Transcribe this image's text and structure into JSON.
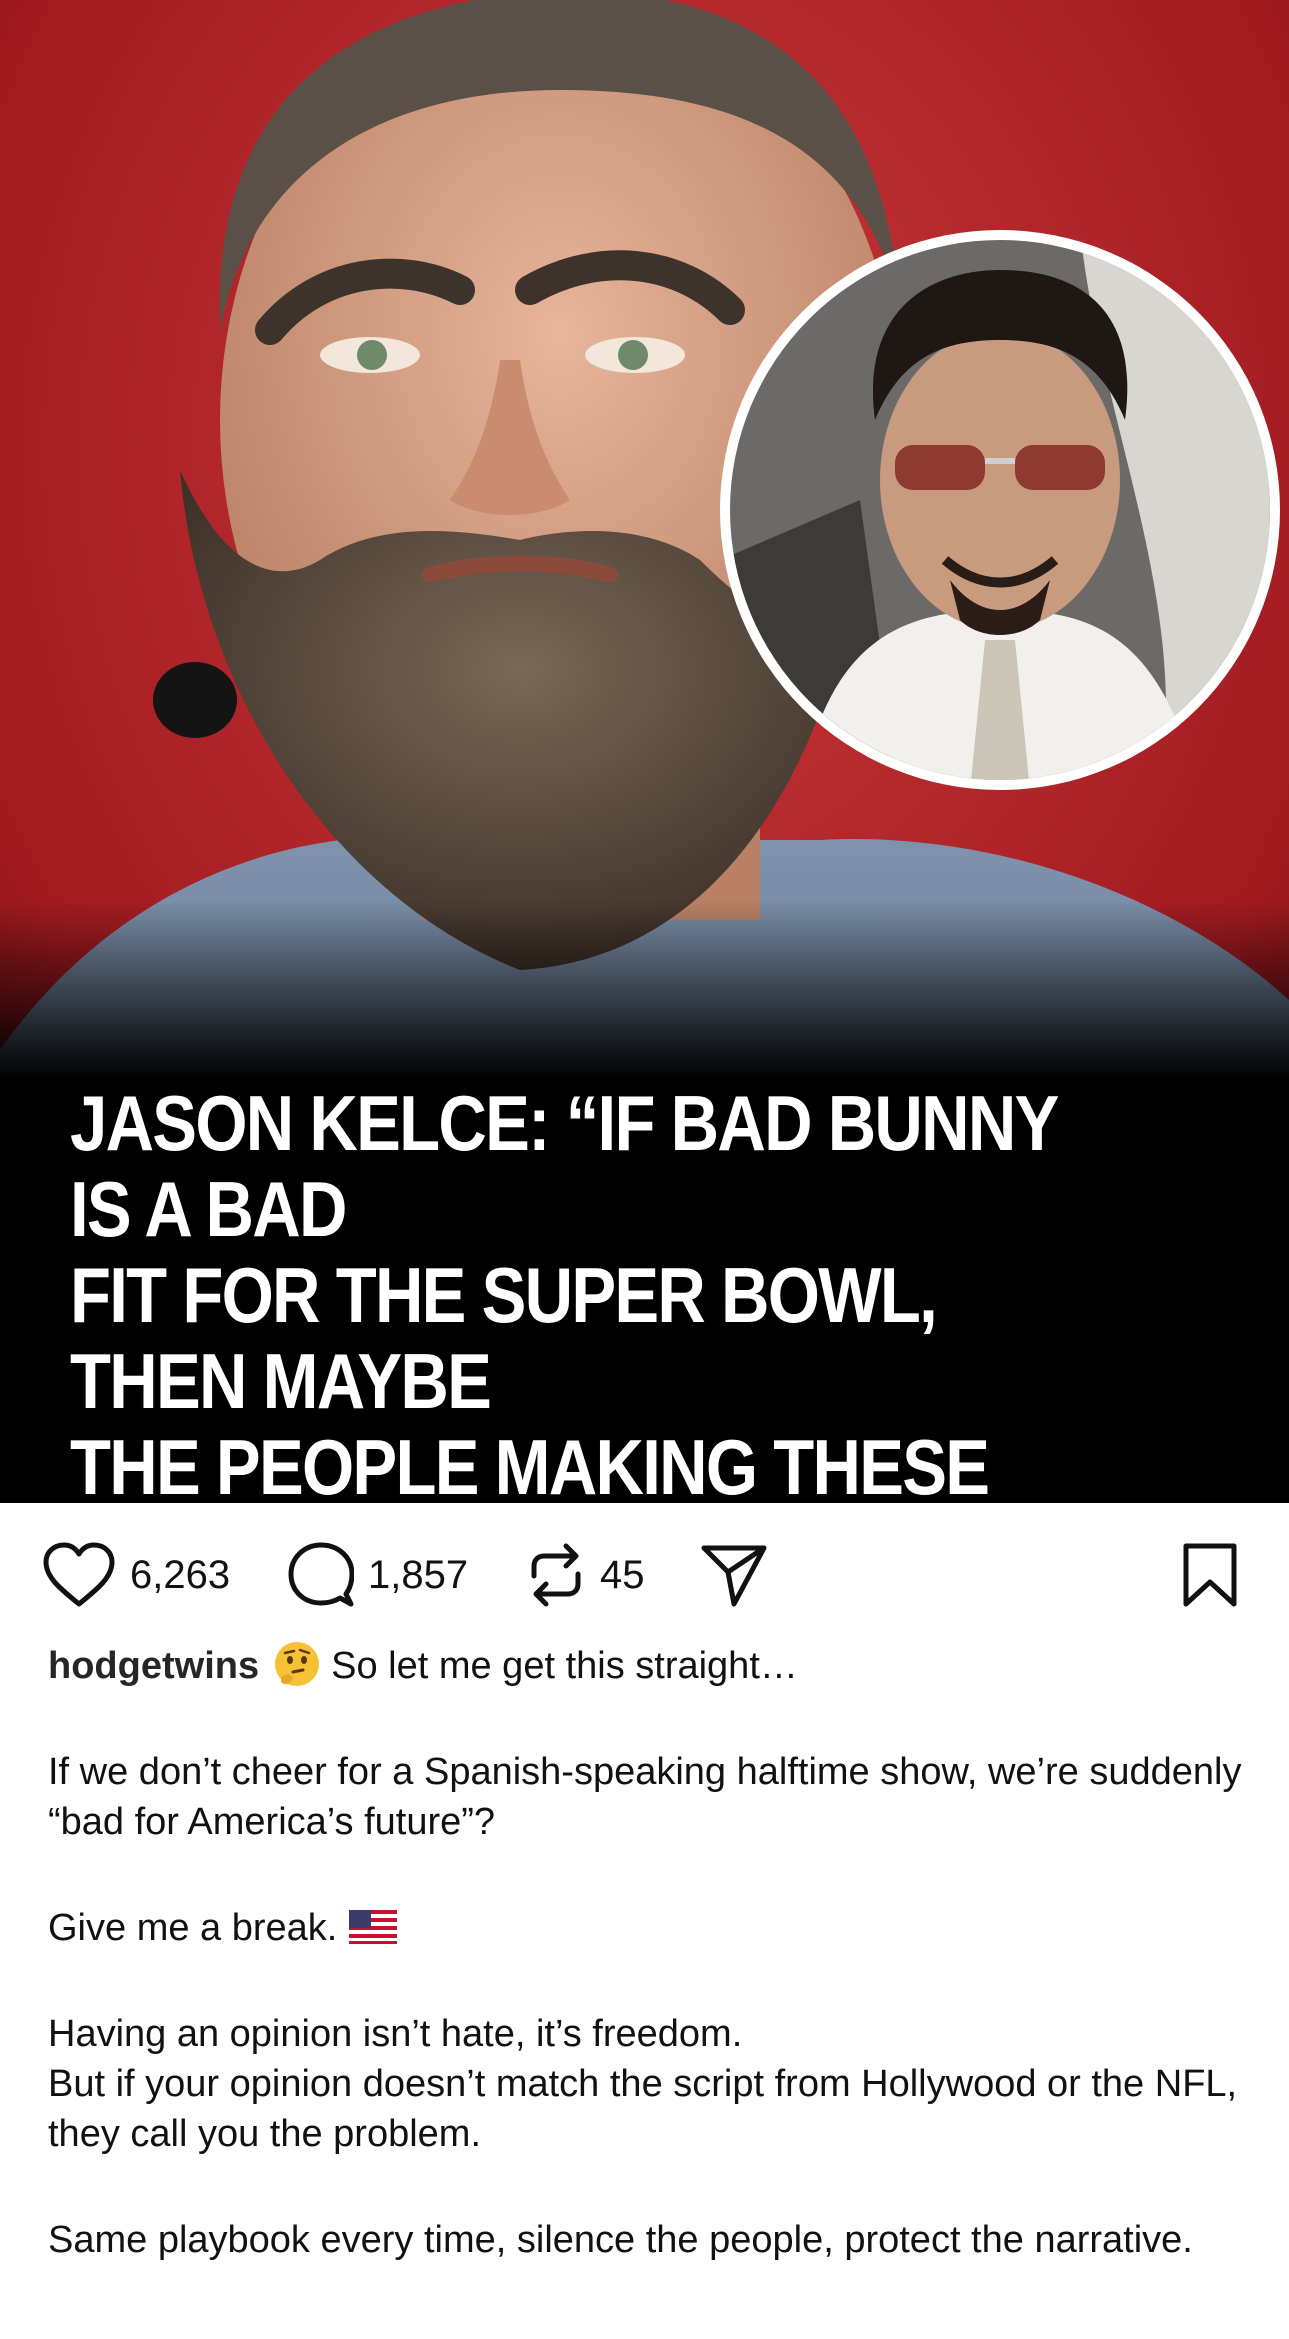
{
  "post": {
    "headline": "JASON KELCE: “IF BAD BUNNY IS A BAD\nFIT FOR THE SUPER BOWL, THEN MAYBE\nTHE PEOPLE MAKING THESE COMMENTS\nARE A BAD FIT FOR AMERICA’S FUTURE.”",
    "colors": {
      "background": "#b51f25",
      "headline_band": "#000000",
      "headline_text": "#ffffff"
    }
  },
  "actions": {
    "likes": "6,263",
    "comments": "1,857",
    "reposts": "45",
    "icons": [
      "heart-icon",
      "comment-icon",
      "repost-icon",
      "share-icon",
      "bookmark-icon"
    ]
  },
  "caption": {
    "username": "hodgetwins",
    "first_line": "So let me get this straight…",
    "para1": "If we don’t cheer for a Spanish-speaking halftime show, we’re suddenly “bad for America’s future”?",
    "para2": "Give me a break.",
    "para3_line1": "Having an opinion isn’t hate, it’s freedom.",
    "para3_line2": "But if your opinion doesn’t match the script from Hollywood or the NFL, they call you the problem.",
    "para4": "Same playbook every time, silence the people, protect the narrative."
  }
}
